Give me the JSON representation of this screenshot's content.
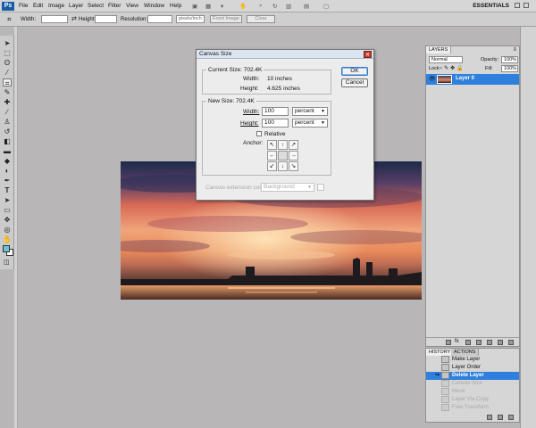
{
  "menubar": {
    "logo": "Ps",
    "items": [
      "File",
      "Edit",
      "Image",
      "Layer",
      "Select",
      "Filter",
      "View",
      "Window",
      "Help"
    ],
    "workspace": "ESSENTIALS"
  },
  "options": {
    "width_label": "Width:",
    "height_label": "Height:",
    "resolution_label": "Resolution:",
    "resolution_unit": "pixels/inch",
    "front_image": "Front Image",
    "clear": "Clear"
  },
  "dialog": {
    "title": "Canvas Size",
    "current_size_label": "Current Size: 702.4K",
    "width_label": "Width:",
    "width_value": "10 inches",
    "height_label": "Height:",
    "height_value": "4.625 inches",
    "new_size_label": "New Size: 702.4K",
    "new_width": "100",
    "new_height": "100",
    "unit": "percent",
    "relative_label": "Relative",
    "anchor_label": "Anchor:",
    "ok": "OK",
    "cancel": "Cancel",
    "extension_label": "Canvas extension color:",
    "extension_value": "Background"
  },
  "layers": {
    "tab": "LAYERS",
    "blend_mode": "Normal",
    "opacity_label": "Opacity:",
    "opacity": "100%",
    "lock_label": "Lock:",
    "fill_label": "Fill:",
    "fill": "100%",
    "layer_name": "Layer 0"
  },
  "history": {
    "tabs": [
      "HISTORY",
      "ACTIONS"
    ],
    "items": [
      "Make Layer",
      "Layer Order",
      "Delete Layer",
      "Canvas Size",
      "Move",
      "Layer Via Copy",
      "Free Transform"
    ]
  },
  "colors": {
    "selected": "#2f7fdc",
    "foreground": "#70c0d8"
  }
}
